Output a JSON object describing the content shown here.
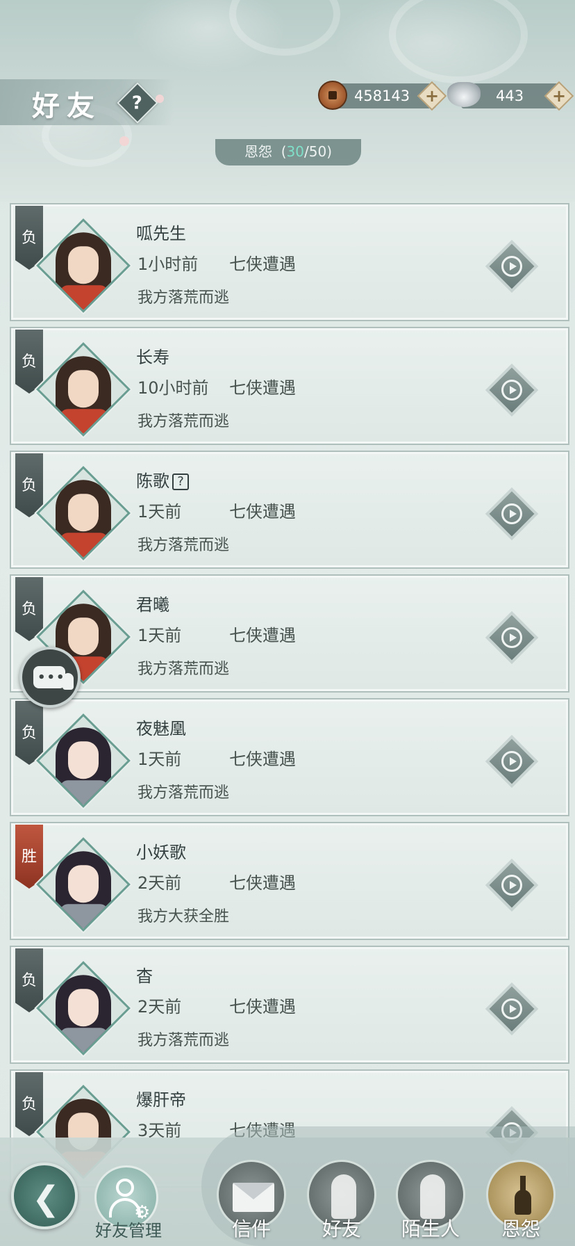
{
  "header": {
    "title": "好友",
    "help_label": "?",
    "copper": "458143",
    "silver": "443",
    "plus_label": "+"
  },
  "enmity": {
    "label": "恩怨",
    "current": "30",
    "max": "50"
  },
  "records": [
    {
      "badge": "负",
      "outcome": "loss",
      "name": "呱先生",
      "has_question": false,
      "time": "1小时前",
      "event": "七侠遭遇",
      "result": "我方落荒而逃",
      "avatar": "male"
    },
    {
      "badge": "负",
      "outcome": "loss",
      "name": "长寿",
      "has_question": false,
      "time": "10小时前",
      "event": "七侠遭遇",
      "result": "我方落荒而逃",
      "avatar": "male"
    },
    {
      "badge": "负",
      "outcome": "loss",
      "name": "陈歌",
      "has_question": true,
      "time": "1天前",
      "event": "七侠遭遇",
      "result": "我方落荒而逃",
      "avatar": "male"
    },
    {
      "badge": "负",
      "outcome": "loss",
      "name": "君曦",
      "has_question": false,
      "time": "1天前",
      "event": "七侠遭遇",
      "result": "我方落荒而逃",
      "avatar": "male"
    },
    {
      "badge": "负",
      "outcome": "loss",
      "name": "夜魅凰",
      "has_question": false,
      "time": "1天前",
      "event": "七侠遭遇",
      "result": "我方落荒而逃",
      "avatar": "female"
    },
    {
      "badge": "胜",
      "outcome": "win",
      "name": "小妖歌",
      "has_question": false,
      "time": "2天前",
      "event": "七侠遭遇",
      "result": "我方大获全胜",
      "avatar": "female"
    },
    {
      "badge": "负",
      "outcome": "loss",
      "name": "杳",
      "has_question": false,
      "time": "2天前",
      "event": "七侠遭遇",
      "result": "我方落荒而逃",
      "avatar": "female"
    },
    {
      "badge": "负",
      "outcome": "loss",
      "name": "爆肝帝",
      "has_question": false,
      "time": "3天前",
      "event": "七侠遭遇",
      "result": "",
      "avatar": "male"
    }
  ],
  "bottom_nav": {
    "manage_label": "好友管理",
    "tabs": [
      {
        "label": "信件",
        "icon": "envelope-icon"
      },
      {
        "label": "好友",
        "icon": "friend-icon"
      },
      {
        "label": "陌生人",
        "icon": "stranger-icon"
      },
      {
        "label": "恩怨",
        "icon": "enmity-icon",
        "active": true
      }
    ]
  }
}
